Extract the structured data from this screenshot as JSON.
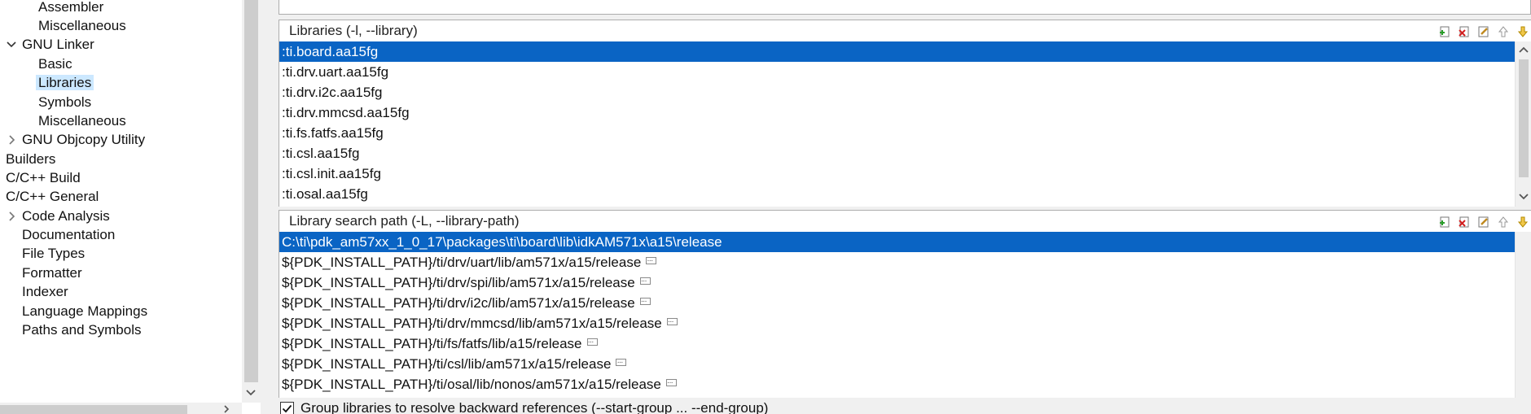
{
  "tree": {
    "items": [
      {
        "label": "Assembler",
        "level": 2
      },
      {
        "label": "Miscellaneous",
        "level": 2
      },
      {
        "label": "GNU Linker",
        "level": 1,
        "expanded": true
      },
      {
        "label": "Basic",
        "level": 2
      },
      {
        "label": "Libraries",
        "level": 2,
        "selected": true
      },
      {
        "label": "Symbols",
        "level": 2
      },
      {
        "label": "Miscellaneous",
        "level": 2
      },
      {
        "label": "GNU Objcopy Utility",
        "level": 1,
        "expanded": false
      },
      {
        "label": "Builders",
        "level": 0
      },
      {
        "label": "C/C++ Build",
        "level": 0
      },
      {
        "label": "C/C++ General",
        "level": 0
      },
      {
        "label": "Code Analysis",
        "level": 1,
        "expanded": false
      },
      {
        "label": "Documentation",
        "level": 1
      },
      {
        "label": "File Types",
        "level": 1
      },
      {
        "label": "Formatter",
        "level": 1
      },
      {
        "label": "Indexer",
        "level": 1
      },
      {
        "label": "Language Mappings",
        "level": 1
      },
      {
        "label": "Paths and Symbols",
        "level": 1
      }
    ]
  },
  "libraries": {
    "title": "Libraries (-l, --library)",
    "items": [
      ":ti.board.aa15fg",
      ":ti.drv.uart.aa15fg",
      ":ti.drv.i2c.aa15fg",
      ":ti.drv.mmcsd.aa15fg",
      ":ti.fs.fatfs.aa15fg",
      ":ti.csl.aa15fg",
      ":ti.csl.init.aa15fg",
      ":ti.osal.aa15fg"
    ],
    "selected_index": 0
  },
  "search_paths": {
    "title": "Library search path (-L, --library-path)",
    "items": [
      "C:\\ti\\pdk_am57xx_1_0_17\\packages\\ti\\board\\lib\\idkAM571x\\a15\\release",
      "${PDK_INSTALL_PATH}/ti/drv/uart/lib/am571x/a15/release",
      "${PDK_INSTALL_PATH}/ti/drv/spi/lib/am571x/a15/release",
      "${PDK_INSTALL_PATH}/ti/drv/i2c/lib/am571x/a15/release",
      "${PDK_INSTALL_PATH}/ti/drv/mmcsd/lib/am571x/a15/release",
      "${PDK_INSTALL_PATH}/ti/fs/fatfs/lib/a15/release",
      "${PDK_INSTALL_PATH}/ti/csl/lib/am571x/a15/release",
      "${PDK_INSTALL_PATH}/ti/osal/lib/nonos/am571x/a15/release"
    ],
    "selected_index": 0
  },
  "toolbar_icons": [
    "add-icon",
    "delete-icon",
    "edit-icon",
    "move-up-icon",
    "move-down-icon"
  ],
  "group_option": {
    "label": "Group libraries to resolve backward references (--start-group ... --end-group)",
    "checked": true
  },
  "colors": {
    "selection": "#0a64c4",
    "tree_selection": "#cce8ff",
    "border": "#adadad"
  }
}
